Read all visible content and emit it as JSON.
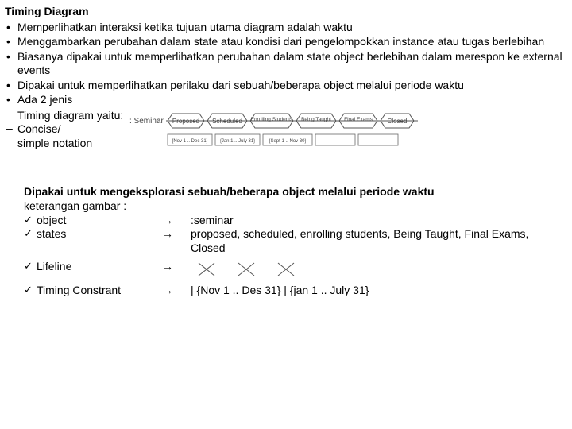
{
  "title": "Timing Diagram",
  "bullets": [
    "Memperlihatkan interaksi ketika tujuan utama diagram adalah waktu",
    "Menggambarkan perubahan dalam state atau kondisi dari pengelompokkan instance atau tugas berlebihan",
    "Biasanya dipakai untuk memperlihatkan perubahan dalam state object berlebihan dalam merespon ke external events",
    "Dipakai untuk memperlihatkan perilaku dari sebuah/beberapa object melalui periode waktu",
    "Ada 2 jenis"
  ],
  "sub_line": "Timing diagram yaitu:",
  "concise1": "Concise/",
  "concise2": "simple notation",
  "diagram": {
    "object": ": Seminar",
    "states": [
      "Proposed",
      "Scheduled",
      "Enrolling Students",
      "Being Taught",
      "Final Exams",
      "Closed"
    ],
    "timeboxes": [
      "{Nov 1 .. Dec 31}",
      "{Jan 1 .. July 31}",
      "{Sept 1 .. Nov 30}",
      "",
      ""
    ]
  },
  "bottom_caption": "Dipakai untuk mengeksplorasi sebuah/beberapa object melalui periode waktu",
  "legend_title": "keterangan gambar :",
  "legend": {
    "object_label": "object",
    "object_value": ":seminar",
    "states_label": "states",
    "states_value": "proposed, scheduled, enrolling students, Being Taught, Final Exams, Closed",
    "lifeline_label": "Lifeline",
    "constraint_label": "Timing Constrant",
    "constraint_value": "| {Nov 1 .. Des 31} | {jan 1 .. July 31}"
  },
  "arrow": "→"
}
